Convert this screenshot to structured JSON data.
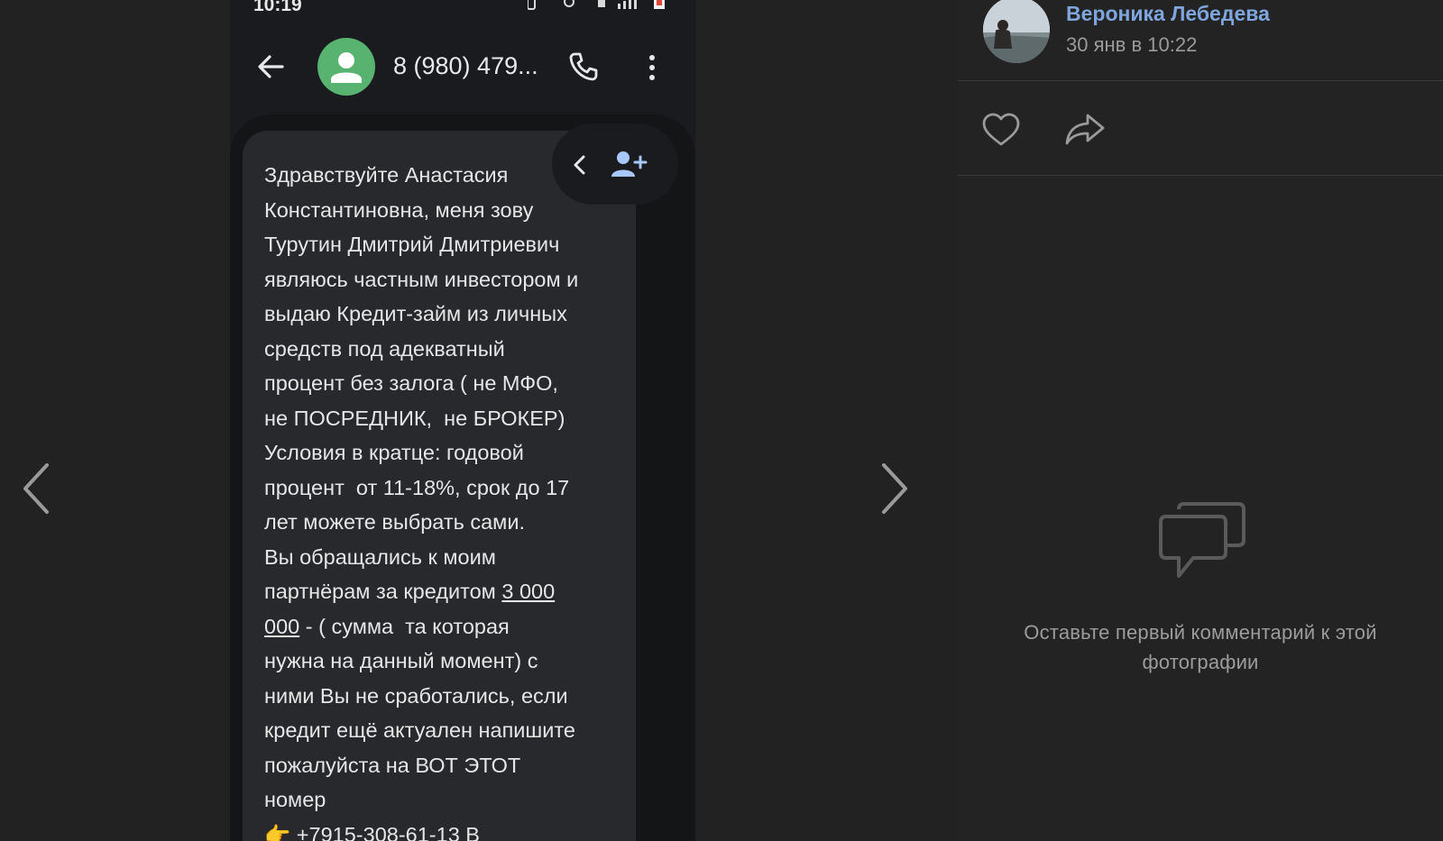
{
  "phone": {
    "status_time": "10:19",
    "contact_name": "8 (980) 479...",
    "message_lines": [
      "Здравствуйте Анастасия",
      "Константиновна, меня зову",
      "Турутин Дмитрий Дмитриевич",
      "являюсь частным инвестором и",
      "выдаю Кредит-займ из личных",
      "средств под адекватный",
      "процент без залога ( не МФО,",
      "не ПОСРЕДНИК,  не БРОКЕР)",
      "Условия в кратце: годовой",
      "процент  от 11-18%, срок до 17",
      "лет можете выбрать сами.",
      "Вы обращались к моим"
    ],
    "line_partners": "партнёрам за кредитом ",
    "amount_part1": "3 000",
    "amount_part2": "000",
    "amount_tail": " - ( сумма  та которая",
    "message_lines_2": [
      "нужна на данный момент) с",
      "ними Вы не сработались, если",
      "кредит ещё актуален напишите",
      "пожалуйста на ВОТ ЭТОТ",
      "номер"
    ],
    "pointing_emoji": "👉",
    "phone_link": "+7915-308-61-13",
    "phone_link_tail": " В"
  },
  "post": {
    "author_name": "Вероника Лебедева",
    "date": "30 янв в 10:22",
    "empty_comments_text": "Оставьте первый комментарий к этой фотографии"
  },
  "icons": {
    "prev": "chevron-left-icon",
    "next": "chevron-right-icon",
    "like": "heart-icon",
    "share": "share-icon",
    "comments": "comments-icon"
  },
  "colors": {
    "accent_link": "#7ea5dc",
    "contact_avatar": "#57b36f",
    "add_contact": "#a8c7fa"
  }
}
